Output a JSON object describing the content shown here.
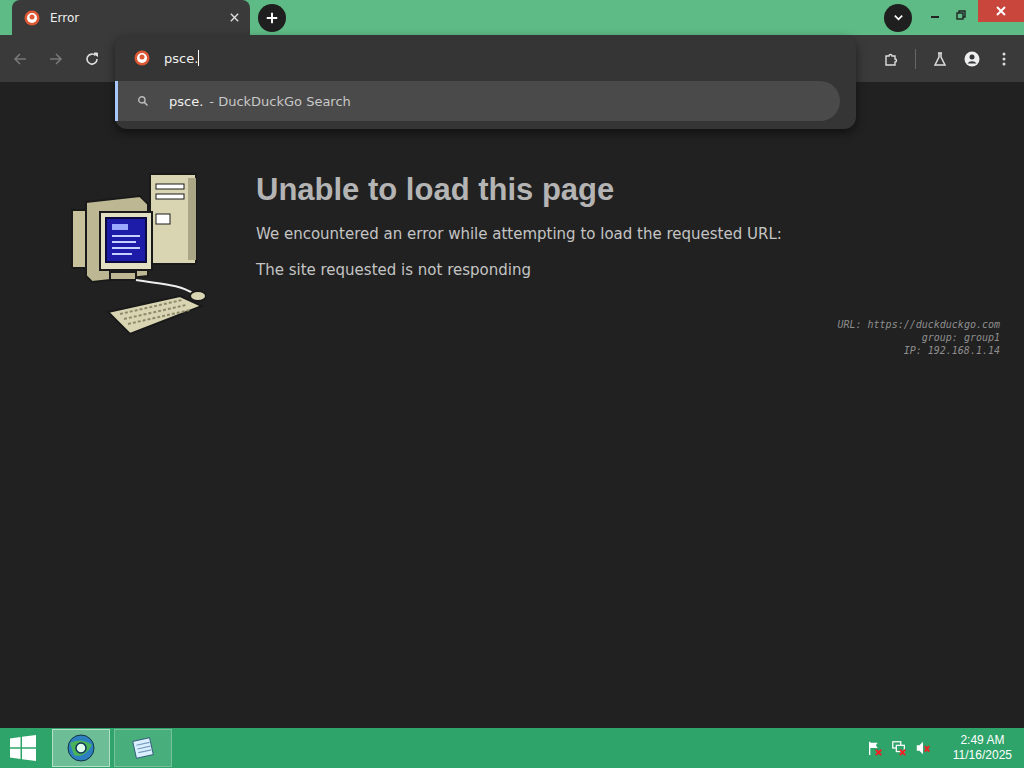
{
  "browser": {
    "tabs": [
      {
        "label": "Error",
        "selected": true
      }
    ],
    "address": {
      "value": "psce."
    },
    "suggestions": [
      {
        "query": "psce.",
        "source": "- DuckDuckGo Search",
        "selected": true
      }
    ]
  },
  "page": {
    "title": "Unable to load this page",
    "message": "We encountered an error while attempting to load the requested URL:",
    "detail": "The site requested is not responding",
    "info": [
      {
        "label": "URL:",
        "value": "https://duckduckgo.com"
      },
      {
        "label": "group:",
        "value": "group1"
      },
      {
        "label": "IP:",
        "value": "192.168.1.14"
      }
    ]
  },
  "taskbar": {
    "apps": [
      {
        "selected": true
      },
      {
        "selected": false
      }
    ],
    "tray": {
      "alerts": true,
      "network_alert": true,
      "muted": true
    },
    "clock": {
      "time": "2:49 AM",
      "date": "11/16/2025"
    }
  }
}
